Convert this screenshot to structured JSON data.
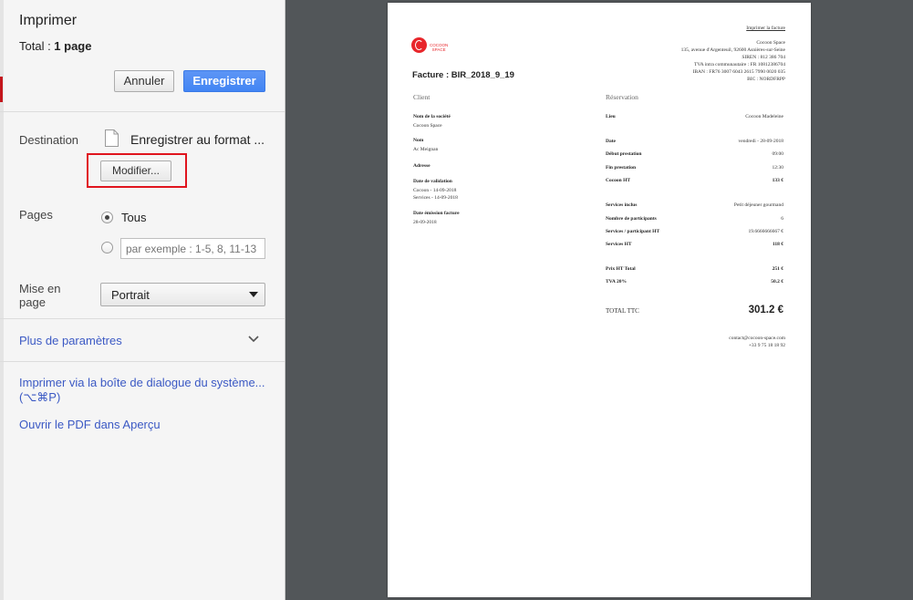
{
  "dialog": {
    "title": "Imprimer",
    "total_label": "Total : ",
    "total_value": "1 page",
    "cancel_label": "Annuler",
    "save_label": "Enregistrer",
    "destination_label": "Destination",
    "destination_value": "Enregistrer au format ...",
    "modify_label": "Modifier...",
    "pages_label": "Pages",
    "pages_all_label": "Tous",
    "pages_placeholder": "par exemple : 1-5, 8, 11-13",
    "pages_selected": "all",
    "layout_label": "Mise en page",
    "layout_value": "Portrait",
    "more_settings_label": "Plus de paramètres",
    "system_dialog_label": "Imprimer via la boîte de dialogue du système... (⌥⌘P)",
    "open_pdf_label": "Ouvrir le PDF dans Aperçu"
  },
  "icons": {
    "file": "file-icon",
    "chevron": "chevron-down-icon",
    "logo": "cocoon-logo"
  },
  "colors": {
    "primary_button": "#4285f4",
    "link": "#3b59c4",
    "highlight_box": "#e0141e",
    "preview_background": "#525659",
    "brand_red": "#e8262b"
  },
  "invoice": {
    "print_link": "Imprimer la facture",
    "logo_text_1": "COCOON",
    "logo_text_2": "SPACE",
    "title": "Facture : BIR_2018_9_19",
    "company": [
      "Cocoon Space",
      "135, avenue d'Argenteuil, 92600 Asnières-sur-Seine",
      "SIREN : 812 386 704",
      "TVA intra communautaire : FR 10812386704",
      "IBAN : FR76 3007 6043 2615 7990 0020 035",
      "BIC : NORDFRPP"
    ],
    "client_heading": "Client",
    "company_name_label": "Nom de la société",
    "company_name_value": "Cocoon Space",
    "name_label": "Nom",
    "name_value": "Ac Meignan",
    "address_label": "Adresse",
    "validation_label": "Date de validation",
    "validation_cocoon": "Cocoon - 14-09-2018",
    "validation_services": "Services - 14-09-2018",
    "issue_label": "Date émission facture",
    "issue_value": "28-09-2018",
    "reservation_heading": "Réservation",
    "rows": [
      {
        "label": "Lieu",
        "value": "Cocoon Madeleine",
        "bold": false
      },
      {
        "label": "Date",
        "value": "vendredi - 28-09-2018",
        "bold": false
      },
      {
        "label": "Début prestation",
        "value": "09:00",
        "bold": false
      },
      {
        "label": "Fin prestation",
        "value": "12:30",
        "bold": false
      },
      {
        "label": "Cocoon HT",
        "value": "133 €",
        "bold": true
      },
      {
        "label": "Services inclus",
        "value": "Petit déjeuner gourmand",
        "bold": false
      },
      {
        "label": "Nombre de participants",
        "value": "6",
        "bold": false
      },
      {
        "label": "Services / participant HT",
        "value": "19.6666666667 €",
        "bold": false
      },
      {
        "label": "Services HT",
        "value": "118 €",
        "bold": true
      },
      {
        "label": "Prix HT Total",
        "value": "251 €",
        "bold": true
      },
      {
        "label": "TVA 20%",
        "value": "50.2 €",
        "bold": true
      }
    ],
    "total_ttc_label": "TOTAL TTC",
    "total_ttc_value": "301.2 €",
    "contact_email": "contact@cocoon-space.com",
    "contact_phone": "+33 9 75 18 18 92"
  }
}
